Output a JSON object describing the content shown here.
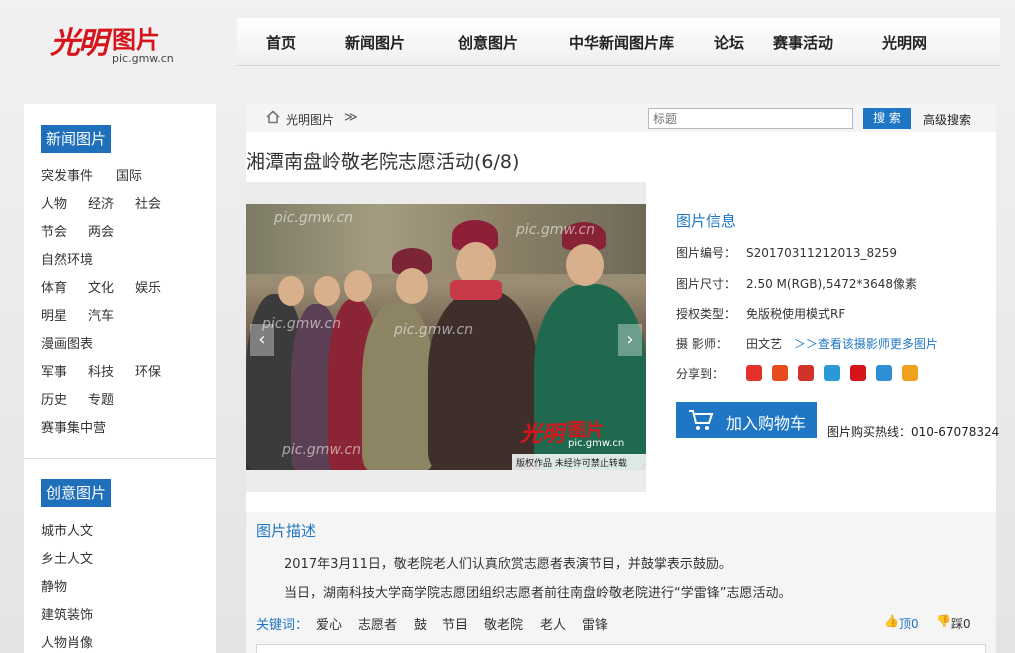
{
  "logo": {
    "script": "光明",
    "word": "图片",
    "url": "pic.gmw.cn"
  },
  "nav": [
    "首页",
    "新闻图片",
    "创意图片",
    "中华新闻图片库",
    "论坛",
    "赛事活动",
    "光明网"
  ],
  "sidebar": {
    "news_title": "新闻图片",
    "news_rows": [
      [
        "突发事件",
        "国际"
      ],
      [
        "人物",
        "经济",
        "社会"
      ],
      [
        "节会",
        "两会"
      ],
      [
        "自然环境"
      ],
      [
        "体育",
        "文化",
        "娱乐"
      ],
      [
        "明星",
        "汽车"
      ],
      [
        "漫画图表"
      ],
      [
        "军事",
        "科技",
        "环保"
      ],
      [
        "历史",
        "专题"
      ],
      [
        "赛事集中营"
      ]
    ],
    "creative_title": "创意图片",
    "creative_items": [
      "城市人文",
      "乡土人文",
      "静物",
      "建筑装饰",
      "人物肖像"
    ]
  },
  "breadcrumb": {
    "home": "光明图片",
    "sep": "≫"
  },
  "search": {
    "placeholder": "标题",
    "button": "搜 索",
    "advanced": "高级搜索"
  },
  "title": "湘潭南盘岭敬老院志愿活动(6/8)",
  "photo": {
    "watermark": "pic.gmw.cn",
    "logo_script": "光明",
    "logo_word": "图片",
    "logo_url": "pic.gmw.cn",
    "copyright": "版权作品  未经许可禁止转载"
  },
  "info": {
    "heading": "图片信息",
    "id_label": "图片编号：",
    "id_value": "S20170311212013_8259",
    "size_label": "图片尺寸：",
    "size_value": "2.50 M(RGB),5472*3648像素",
    "license_label": "授权类型：",
    "license_value": "免版税使用模式RF",
    "photographer_label": "摄  影师：",
    "photographer_value": "田文艺",
    "more_link": "＞＞查看该摄影师更多图片",
    "share_label": "分享到：",
    "share_colors": [
      "#e3322b",
      "#e64c1e",
      "#d1322a",
      "#2a9ad7",
      "#d7141c",
      "#2e8fd6",
      "#f0a21f"
    ],
    "cart_label": "加入购物车",
    "hotline": "图片购买热线：010-67078324"
  },
  "description": {
    "heading": "图片描述",
    "line1": "2017年3月11日，敬老院老人们认真欣赏志愿者表演节目，并鼓掌表示鼓励。",
    "line2": "当日，湖南科技大学商学院志愿团组织志愿者前往南盘岭敬老院进行“学雷锋”志愿活动。",
    "keywords_label": "关键词：",
    "keywords": [
      "爱心",
      "志愿者",
      "鼓",
      "节目",
      "敬老院",
      "老人",
      "雷锋"
    ],
    "up": "顶0",
    "down": "踩0"
  }
}
